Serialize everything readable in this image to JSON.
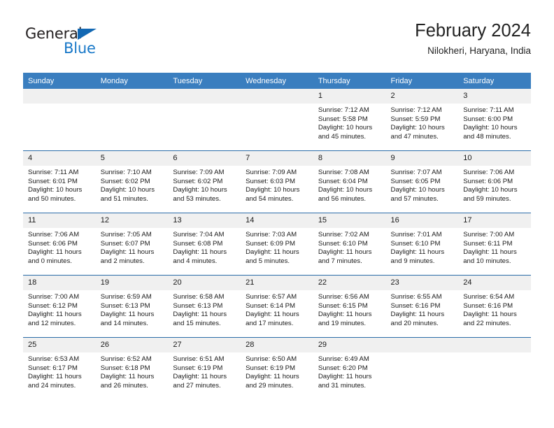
{
  "brand": {
    "name_top": "General",
    "name_bottom": "Blue",
    "triangle_color": "#1268b3",
    "blue_color": "#1878c8"
  },
  "header": {
    "title": "February 2024",
    "subtitle": "Nilokheri, Haryana, India"
  },
  "theme": {
    "header_row_bg": "#3a7ebf",
    "header_row_text": "#ffffff",
    "daynum_bg": "#f0f0f0",
    "row_divider": "#2b6ca8"
  },
  "weekday_headers": [
    "Sunday",
    "Monday",
    "Tuesday",
    "Wednesday",
    "Thursday",
    "Friday",
    "Saturday"
  ],
  "weeks": [
    [
      {
        "day": "",
        "sunrise": "",
        "sunset": "",
        "daylight_line1": "",
        "daylight_line2": ""
      },
      {
        "day": "",
        "sunrise": "",
        "sunset": "",
        "daylight_line1": "",
        "daylight_line2": ""
      },
      {
        "day": "",
        "sunrise": "",
        "sunset": "",
        "daylight_line1": "",
        "daylight_line2": ""
      },
      {
        "day": "",
        "sunrise": "",
        "sunset": "",
        "daylight_line1": "",
        "daylight_line2": ""
      },
      {
        "day": "1",
        "sunrise": "Sunrise: 7:12 AM",
        "sunset": "Sunset: 5:58 PM",
        "daylight_line1": "Daylight: 10 hours",
        "daylight_line2": "and 45 minutes."
      },
      {
        "day": "2",
        "sunrise": "Sunrise: 7:12 AM",
        "sunset": "Sunset: 5:59 PM",
        "daylight_line1": "Daylight: 10 hours",
        "daylight_line2": "and 47 minutes."
      },
      {
        "day": "3",
        "sunrise": "Sunrise: 7:11 AM",
        "sunset": "Sunset: 6:00 PM",
        "daylight_line1": "Daylight: 10 hours",
        "daylight_line2": "and 48 minutes."
      }
    ],
    [
      {
        "day": "4",
        "sunrise": "Sunrise: 7:11 AM",
        "sunset": "Sunset: 6:01 PM",
        "daylight_line1": "Daylight: 10 hours",
        "daylight_line2": "and 50 minutes."
      },
      {
        "day": "5",
        "sunrise": "Sunrise: 7:10 AM",
        "sunset": "Sunset: 6:02 PM",
        "daylight_line1": "Daylight: 10 hours",
        "daylight_line2": "and 51 minutes."
      },
      {
        "day": "6",
        "sunrise": "Sunrise: 7:09 AM",
        "sunset": "Sunset: 6:02 PM",
        "daylight_line1": "Daylight: 10 hours",
        "daylight_line2": "and 53 minutes."
      },
      {
        "day": "7",
        "sunrise": "Sunrise: 7:09 AM",
        "sunset": "Sunset: 6:03 PM",
        "daylight_line1": "Daylight: 10 hours",
        "daylight_line2": "and 54 minutes."
      },
      {
        "day": "8",
        "sunrise": "Sunrise: 7:08 AM",
        "sunset": "Sunset: 6:04 PM",
        "daylight_line1": "Daylight: 10 hours",
        "daylight_line2": "and 56 minutes."
      },
      {
        "day": "9",
        "sunrise": "Sunrise: 7:07 AM",
        "sunset": "Sunset: 6:05 PM",
        "daylight_line1": "Daylight: 10 hours",
        "daylight_line2": "and 57 minutes."
      },
      {
        "day": "10",
        "sunrise": "Sunrise: 7:06 AM",
        "sunset": "Sunset: 6:06 PM",
        "daylight_line1": "Daylight: 10 hours",
        "daylight_line2": "and 59 minutes."
      }
    ],
    [
      {
        "day": "11",
        "sunrise": "Sunrise: 7:06 AM",
        "sunset": "Sunset: 6:06 PM",
        "daylight_line1": "Daylight: 11 hours",
        "daylight_line2": "and 0 minutes."
      },
      {
        "day": "12",
        "sunrise": "Sunrise: 7:05 AM",
        "sunset": "Sunset: 6:07 PM",
        "daylight_line1": "Daylight: 11 hours",
        "daylight_line2": "and 2 minutes."
      },
      {
        "day": "13",
        "sunrise": "Sunrise: 7:04 AM",
        "sunset": "Sunset: 6:08 PM",
        "daylight_line1": "Daylight: 11 hours",
        "daylight_line2": "and 4 minutes."
      },
      {
        "day": "14",
        "sunrise": "Sunrise: 7:03 AM",
        "sunset": "Sunset: 6:09 PM",
        "daylight_line1": "Daylight: 11 hours",
        "daylight_line2": "and 5 minutes."
      },
      {
        "day": "15",
        "sunrise": "Sunrise: 7:02 AM",
        "sunset": "Sunset: 6:10 PM",
        "daylight_line1": "Daylight: 11 hours",
        "daylight_line2": "and 7 minutes."
      },
      {
        "day": "16",
        "sunrise": "Sunrise: 7:01 AM",
        "sunset": "Sunset: 6:10 PM",
        "daylight_line1": "Daylight: 11 hours",
        "daylight_line2": "and 9 minutes."
      },
      {
        "day": "17",
        "sunrise": "Sunrise: 7:00 AM",
        "sunset": "Sunset: 6:11 PM",
        "daylight_line1": "Daylight: 11 hours",
        "daylight_line2": "and 10 minutes."
      }
    ],
    [
      {
        "day": "18",
        "sunrise": "Sunrise: 7:00 AM",
        "sunset": "Sunset: 6:12 PM",
        "daylight_line1": "Daylight: 11 hours",
        "daylight_line2": "and 12 minutes."
      },
      {
        "day": "19",
        "sunrise": "Sunrise: 6:59 AM",
        "sunset": "Sunset: 6:13 PM",
        "daylight_line1": "Daylight: 11 hours",
        "daylight_line2": "and 14 minutes."
      },
      {
        "day": "20",
        "sunrise": "Sunrise: 6:58 AM",
        "sunset": "Sunset: 6:13 PM",
        "daylight_line1": "Daylight: 11 hours",
        "daylight_line2": "and 15 minutes."
      },
      {
        "day": "21",
        "sunrise": "Sunrise: 6:57 AM",
        "sunset": "Sunset: 6:14 PM",
        "daylight_line1": "Daylight: 11 hours",
        "daylight_line2": "and 17 minutes."
      },
      {
        "day": "22",
        "sunrise": "Sunrise: 6:56 AM",
        "sunset": "Sunset: 6:15 PM",
        "daylight_line1": "Daylight: 11 hours",
        "daylight_line2": "and 19 minutes."
      },
      {
        "day": "23",
        "sunrise": "Sunrise: 6:55 AM",
        "sunset": "Sunset: 6:16 PM",
        "daylight_line1": "Daylight: 11 hours",
        "daylight_line2": "and 20 minutes."
      },
      {
        "day": "24",
        "sunrise": "Sunrise: 6:54 AM",
        "sunset": "Sunset: 6:16 PM",
        "daylight_line1": "Daylight: 11 hours",
        "daylight_line2": "and 22 minutes."
      }
    ],
    [
      {
        "day": "25",
        "sunrise": "Sunrise: 6:53 AM",
        "sunset": "Sunset: 6:17 PM",
        "daylight_line1": "Daylight: 11 hours",
        "daylight_line2": "and 24 minutes."
      },
      {
        "day": "26",
        "sunrise": "Sunrise: 6:52 AM",
        "sunset": "Sunset: 6:18 PM",
        "daylight_line1": "Daylight: 11 hours",
        "daylight_line2": "and 26 minutes."
      },
      {
        "day": "27",
        "sunrise": "Sunrise: 6:51 AM",
        "sunset": "Sunset: 6:19 PM",
        "daylight_line1": "Daylight: 11 hours",
        "daylight_line2": "and 27 minutes."
      },
      {
        "day": "28",
        "sunrise": "Sunrise: 6:50 AM",
        "sunset": "Sunset: 6:19 PM",
        "daylight_line1": "Daylight: 11 hours",
        "daylight_line2": "and 29 minutes."
      },
      {
        "day": "29",
        "sunrise": "Sunrise: 6:49 AM",
        "sunset": "Sunset: 6:20 PM",
        "daylight_line1": "Daylight: 11 hours",
        "daylight_line2": "and 31 minutes."
      },
      {
        "day": "",
        "sunrise": "",
        "sunset": "",
        "daylight_line1": "",
        "daylight_line2": ""
      },
      {
        "day": "",
        "sunrise": "",
        "sunset": "",
        "daylight_line1": "",
        "daylight_line2": ""
      }
    ]
  ]
}
